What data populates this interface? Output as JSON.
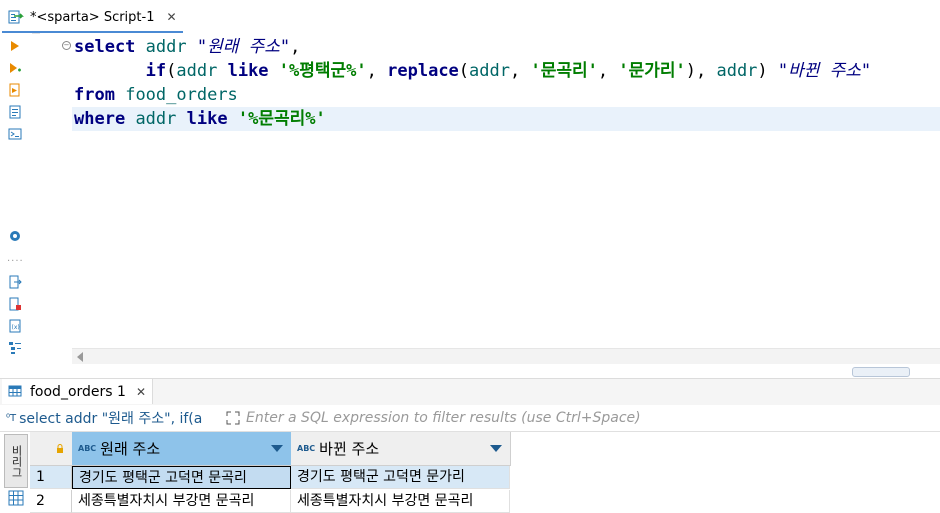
{
  "editor_tab": {
    "label": "*<sparta> Script-1",
    "close": "✕"
  },
  "code": {
    "lines": [
      [
        {
          "t": "select",
          "c": "kw"
        },
        {
          "t": " ",
          "c": "plain"
        },
        {
          "t": "addr",
          "c": "ident"
        },
        {
          "t": " ",
          "c": "plain"
        },
        {
          "t": "\"원래 주소\"",
          "c": "alias"
        },
        {
          "t": ",",
          "c": "plain"
        }
      ],
      [
        {
          "t": "       ",
          "c": "plain"
        },
        {
          "t": "if",
          "c": "fn"
        },
        {
          "t": "(",
          "c": "plain"
        },
        {
          "t": "addr",
          "c": "ident"
        },
        {
          "t": " ",
          "c": "plain"
        },
        {
          "t": "like",
          "c": "kw"
        },
        {
          "t": " ",
          "c": "plain"
        },
        {
          "t": "'%평택군%'",
          "c": "str"
        },
        {
          "t": ", ",
          "c": "plain"
        },
        {
          "t": "replace",
          "c": "fn"
        },
        {
          "t": "(",
          "c": "plain"
        },
        {
          "t": "addr",
          "c": "ident"
        },
        {
          "t": ", ",
          "c": "plain"
        },
        {
          "t": "'문곡리'",
          "c": "str"
        },
        {
          "t": ", ",
          "c": "plain"
        },
        {
          "t": "'문가리'",
          "c": "str"
        },
        {
          "t": "), ",
          "c": "plain"
        },
        {
          "t": "addr",
          "c": "ident"
        },
        {
          "t": ") ",
          "c": "plain"
        },
        {
          "t": "\"바뀐 주소\"",
          "c": "alias"
        }
      ],
      [
        {
          "t": "from",
          "c": "kw"
        },
        {
          "t": " ",
          "c": "plain"
        },
        {
          "t": "food_orders",
          "c": "ident"
        }
      ],
      [
        {
          "t": "where",
          "c": "kw"
        },
        {
          "t": " ",
          "c": "plain"
        },
        {
          "t": "addr",
          "c": "ident"
        },
        {
          "t": " ",
          "c": "plain"
        },
        {
          "t": "like",
          "c": "kw"
        },
        {
          "t": " ",
          "c": "plain"
        },
        {
          "t": "'%문곡리%'",
          "c": "str"
        }
      ]
    ],
    "current_line": 3
  },
  "results_tab": {
    "label": "food_orders 1",
    "close": "✕"
  },
  "filter": {
    "query_text": "select addr \"원래 주소\", if(a",
    "placeholder": "Enter a SQL expression to filter results (use Ctrl+Space)"
  },
  "side_panel": {
    "vertical_label": "비리그"
  },
  "grid": {
    "columns": [
      {
        "type_badge": "ABC",
        "label": "원래 주소",
        "selected": true
      },
      {
        "type_badge": "ABC",
        "label": "바뀐 주소",
        "selected": false
      }
    ],
    "rows": [
      {
        "num": "1",
        "cells": [
          "경기도 평택군 고덕면 문곡리",
          "경기도 평택군 고덕면 문가리"
        ]
      },
      {
        "num": "2",
        "cells": [
          "세종특별자치시 부강면 문곡리",
          "세종특별자치시 부강면 문곡리"
        ]
      }
    ]
  },
  "colors": {
    "keyword": "#000080",
    "identifier": "#006666",
    "string": "#007d00",
    "selected_header": "#8ec3ea",
    "selected_row": "#d7e8f6"
  }
}
